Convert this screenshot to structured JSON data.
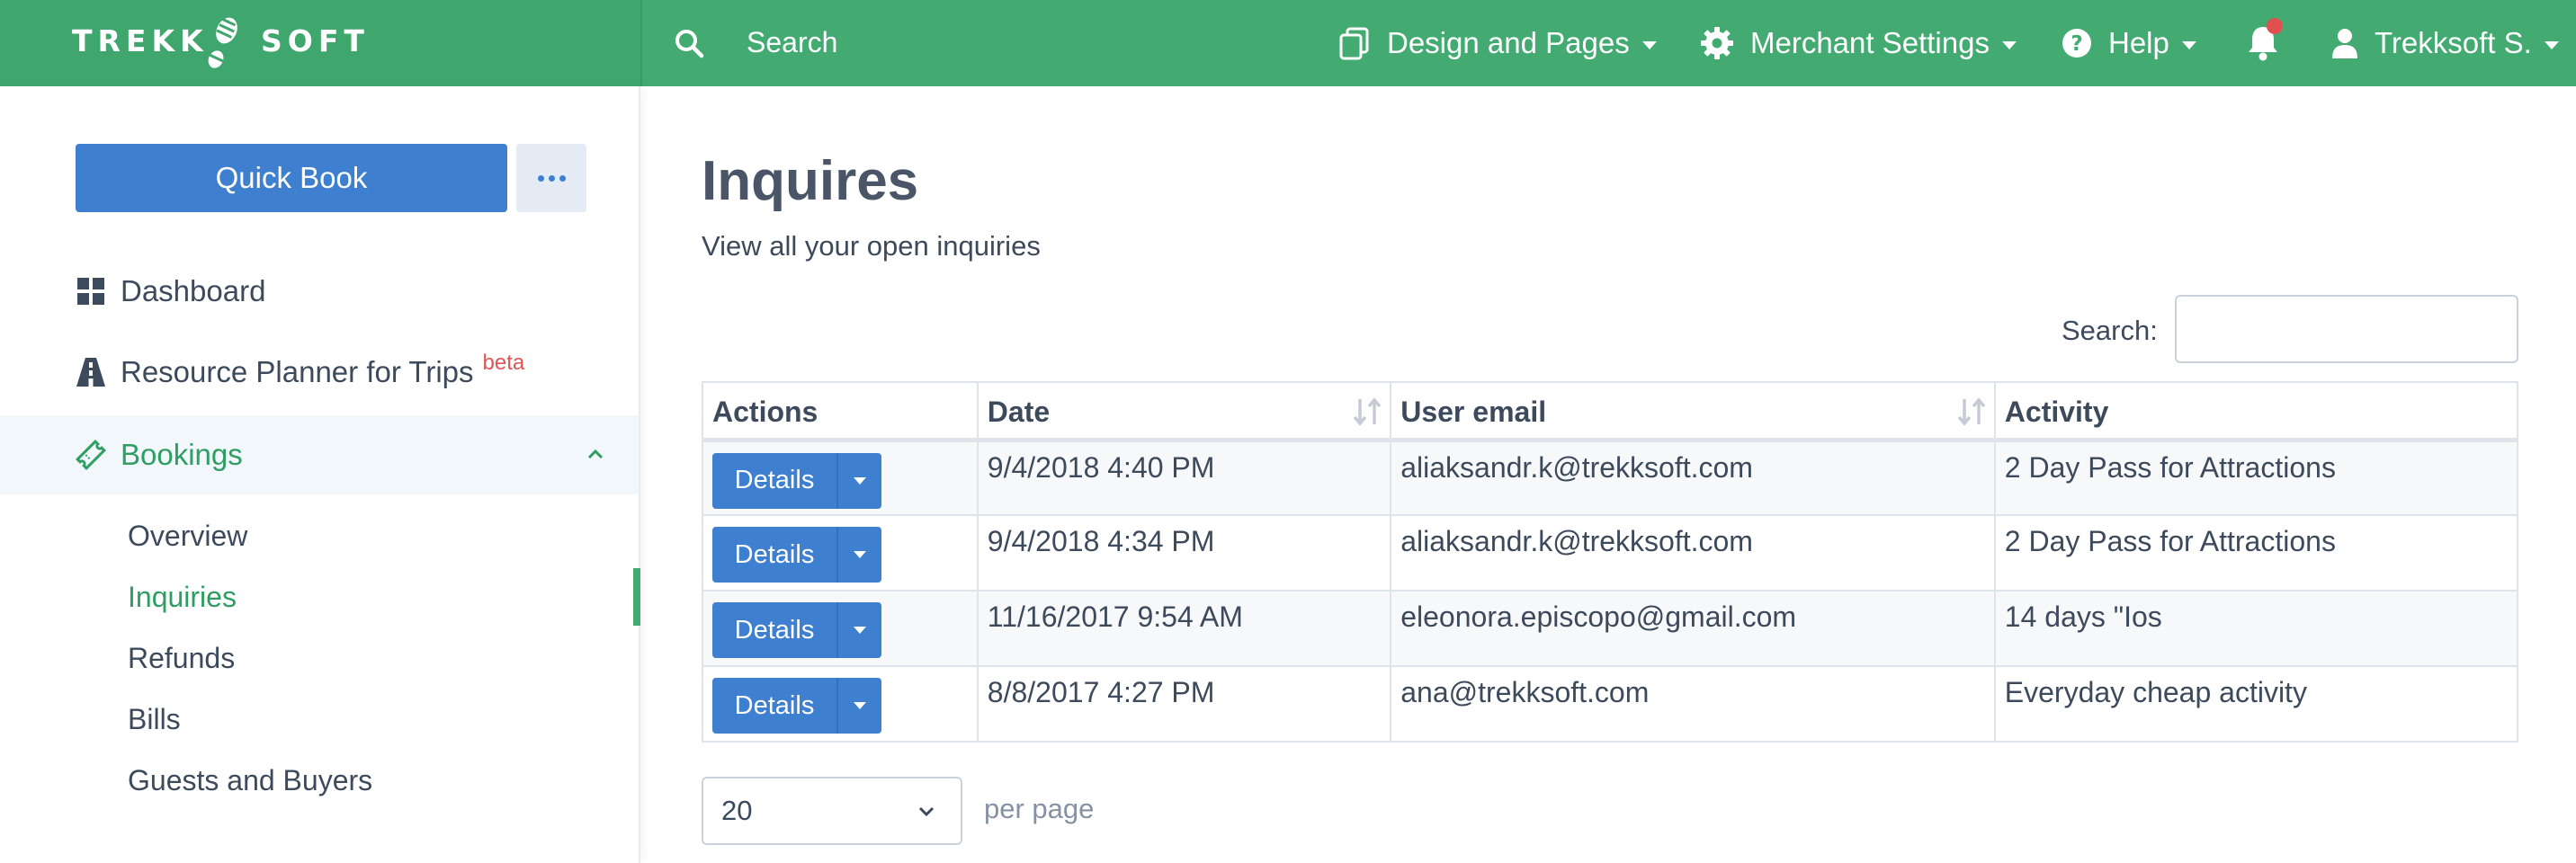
{
  "brand": {
    "left": "TREKK",
    "right": "SOFT"
  },
  "topbar": {
    "search_label": "Search",
    "design_pages": "Design and Pages",
    "merchant_settings": "Merchant Settings",
    "help": "Help",
    "user": "Trekksoft S.",
    "accent_color": "#43ab72",
    "icons": [
      "search-icon",
      "pages-icon",
      "gear-icon",
      "help-icon",
      "bell-icon",
      "user-icon"
    ]
  },
  "sidebar": {
    "quick_book": "Quick Book",
    "dashboard": "Dashboard",
    "resource_planner": "Resource Planner for Trips",
    "beta": "beta",
    "bookings": "Bookings",
    "sub_items": [
      "Overview",
      "Inquiries",
      "Refunds",
      "Bills",
      "Guests and Buyers"
    ],
    "active_sub_item": "Inquiries"
  },
  "main": {
    "title": "Inquires",
    "subtitle": "View all your open inquiries",
    "search_label": "Search:",
    "search_value": "",
    "table": {
      "columns": [
        "Actions",
        "Date",
        "User email",
        "Activity"
      ],
      "details_label": "Details",
      "rows": [
        {
          "date": "9/4/2018 4:40 PM",
          "email": "aliaksandr.k@trekksoft.com",
          "activity": "2 Day Pass for Attractions"
        },
        {
          "date": "9/4/2018 4:34 PM",
          "email": "aliaksandr.k@trekksoft.com",
          "activity": "2 Day Pass for Attractions"
        },
        {
          "date": "11/16/2017 9:54 AM",
          "email": "eleonora.episcopo@gmail.com",
          "activity": "14 days \"Ios"
        },
        {
          "date": "8/8/2017 4:27 PM",
          "email": "ana@trekksoft.com",
          "activity": "Everyday cheap activity"
        }
      ]
    },
    "per_page_value": "20",
    "per_page_label": "per page"
  }
}
